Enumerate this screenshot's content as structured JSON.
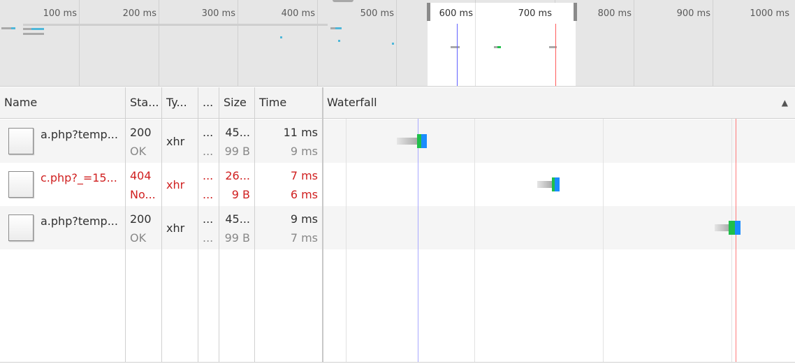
{
  "overview": {
    "ticks": [
      "100 ms",
      "200 ms",
      "300 ms",
      "400 ms",
      "500 ms",
      "600 ms",
      "700 ms",
      "800 ms",
      "900 ms",
      "1000 ms"
    ]
  },
  "columns": {
    "name": "Name",
    "status": "Sta...",
    "type": "Ty...",
    "initiator": "...",
    "size": "Size",
    "time": "Time",
    "waterfall": "Waterfall",
    "sort_indicator": "▲"
  },
  "requests": [
    {
      "name": "a.php?temp...",
      "status": "200",
      "status_text": "OK",
      "type": "xhr",
      "initiator": "...",
      "initiator2": "...",
      "size": "45...",
      "size2": "99 B",
      "time": "11 ms",
      "latency": "9 ms",
      "error": false
    },
    {
      "name": "c.php?_=15...",
      "status": "404",
      "status_text": "No...",
      "type": "xhr",
      "initiator": "...",
      "initiator2": "...",
      "size": "26...",
      "size2": "9 B",
      "time": "7 ms",
      "latency": "6 ms",
      "error": true
    },
    {
      "name": "a.php?temp...",
      "status": "200",
      "status_text": "OK",
      "type": "xhr",
      "initiator": "...",
      "initiator2": "...",
      "size": "45...",
      "size2": "99 B",
      "time": "9 ms",
      "latency": "7 ms",
      "error": false
    }
  ],
  "colors": {
    "dom_content_loaded": "#7b7bff",
    "load_event": "#ff5a5a",
    "waiting": "#1fbf4a",
    "receiving": "#1a8cff",
    "queued": "#b0b0b0",
    "error_text": "#d02020"
  }
}
